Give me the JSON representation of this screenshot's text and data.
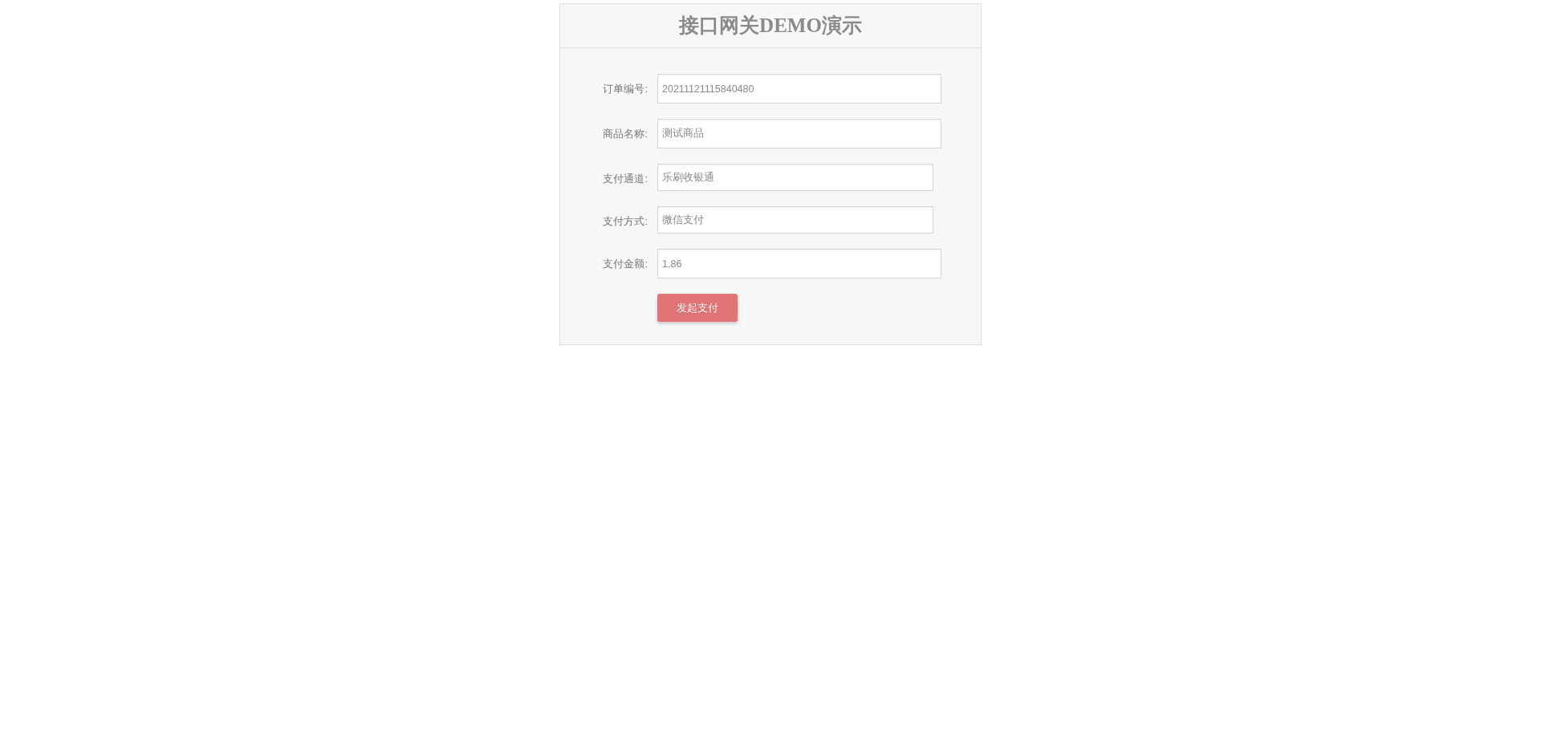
{
  "title": "接口网关DEMO演示",
  "fields": [
    {
      "label": "订单编号:",
      "value": "20211121115840480",
      "kind": "text"
    },
    {
      "label": "商品名称:",
      "value": "测试商品",
      "kind": "text"
    },
    {
      "label": "支付通道:",
      "value": "乐刷收银通",
      "kind": "select"
    },
    {
      "label": "支付方式:",
      "value": "微信支付",
      "kind": "select"
    },
    {
      "label": "支付金额:",
      "value": "1.86",
      "kind": "text"
    }
  ],
  "submit_button": "发起支付"
}
